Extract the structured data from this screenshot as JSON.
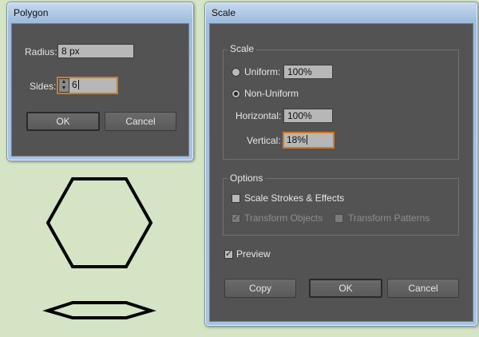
{
  "polygon_dialog": {
    "title": "Polygon",
    "radius_label": "Radius:",
    "radius_value": "8 px",
    "sides_label": "Sides:",
    "sides_value": "6",
    "ok_label": "OK",
    "cancel_label": "Cancel"
  },
  "scale_dialog": {
    "title": "Scale",
    "scale_group_label": "Scale",
    "uniform_label": "Uniform:",
    "uniform_value": "100%",
    "uniform_selected": false,
    "non_uniform_label": "Non-Uniform",
    "non_uniform_selected": true,
    "horizontal_label": "Horizontal:",
    "horizontal_value": "100%",
    "vertical_label": "Vertical:",
    "vertical_value": "18%",
    "options_group_label": "Options",
    "scale_strokes_label": "Scale Strokes & Effects",
    "scale_strokes_checked": false,
    "transform_objects_label": "Transform Objects",
    "transform_objects_checked": true,
    "transform_patterns_label": "Transform Patterns",
    "transform_patterns_checked": false,
    "preview_label": "Preview",
    "preview_checked": true,
    "copy_label": "Copy",
    "ok_label": "OK",
    "cancel_label": "Cancel"
  },
  "colors": {
    "canvas_bg": "#d4e4c4",
    "panel_bg": "#535353",
    "focus_accent": "#d97a1e"
  }
}
